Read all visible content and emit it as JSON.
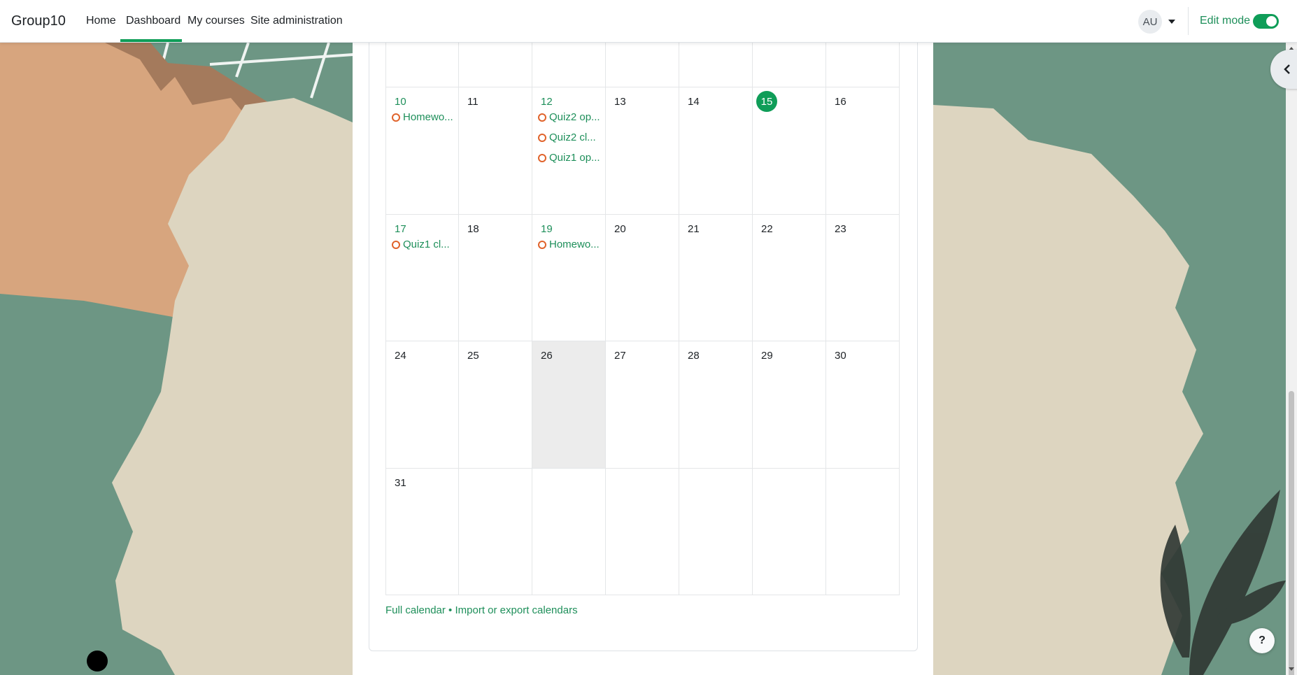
{
  "navbar": {
    "brand": "Group10",
    "items": [
      {
        "label": "Home"
      },
      {
        "label": "Dashboard",
        "active": true
      },
      {
        "label": "My courses"
      },
      {
        "label": "Site administration"
      }
    ],
    "avatar_initials": "AU",
    "edit_mode_label": "Edit mode",
    "edit_mode_on": true
  },
  "calendar": {
    "today": "15",
    "weeks": [
      [
        {
          "day": "",
          "events": []
        },
        {
          "day": "",
          "events": []
        },
        {
          "day": "",
          "events": []
        },
        {
          "day": "",
          "events": []
        },
        {
          "day": "",
          "events": []
        },
        {
          "day": "",
          "events": []
        },
        {
          "day": "",
          "events": []
        }
      ],
      [
        {
          "day": "10",
          "events": [
            "Homewo..."
          ]
        },
        {
          "day": "11",
          "events": []
        },
        {
          "day": "12",
          "events": [
            "Quiz2 op...",
            "Quiz2 cl...",
            "Quiz1 op..."
          ]
        },
        {
          "day": "13",
          "events": []
        },
        {
          "day": "14",
          "events": []
        },
        {
          "day": "15",
          "events": [],
          "today": true
        },
        {
          "day": "16",
          "events": []
        }
      ],
      [
        {
          "day": "17",
          "events": [
            "Quiz1 cl..."
          ]
        },
        {
          "day": "18",
          "events": []
        },
        {
          "day": "19",
          "events": [
            "Homewo..."
          ]
        },
        {
          "day": "20",
          "events": []
        },
        {
          "day": "21",
          "events": []
        },
        {
          "day": "22",
          "events": []
        },
        {
          "day": "23",
          "events": []
        }
      ],
      [
        {
          "day": "24",
          "events": []
        },
        {
          "day": "25",
          "events": []
        },
        {
          "day": "26",
          "events": [],
          "shaded": true
        },
        {
          "day": "27",
          "events": []
        },
        {
          "day": "28",
          "events": []
        },
        {
          "day": "29",
          "events": []
        },
        {
          "day": "30",
          "events": []
        }
      ],
      [
        {
          "day": "31",
          "events": []
        },
        {
          "day": "",
          "events": []
        },
        {
          "day": "",
          "events": []
        },
        {
          "day": "",
          "events": []
        },
        {
          "day": "",
          "events": []
        },
        {
          "day": "",
          "events": []
        },
        {
          "day": "",
          "events": []
        }
      ]
    ],
    "footer": {
      "full_calendar": "Full calendar",
      "separator": " • ",
      "import_export": "Import or export calendars"
    }
  },
  "help_label": "?",
  "colors": {
    "accent": "#0f9d58",
    "link": "#1e8f5a",
    "event_dot": "#e0632b",
    "background_green": "#6d9684",
    "paper": "#ddd5c0",
    "kraft": "#d7a57e"
  }
}
